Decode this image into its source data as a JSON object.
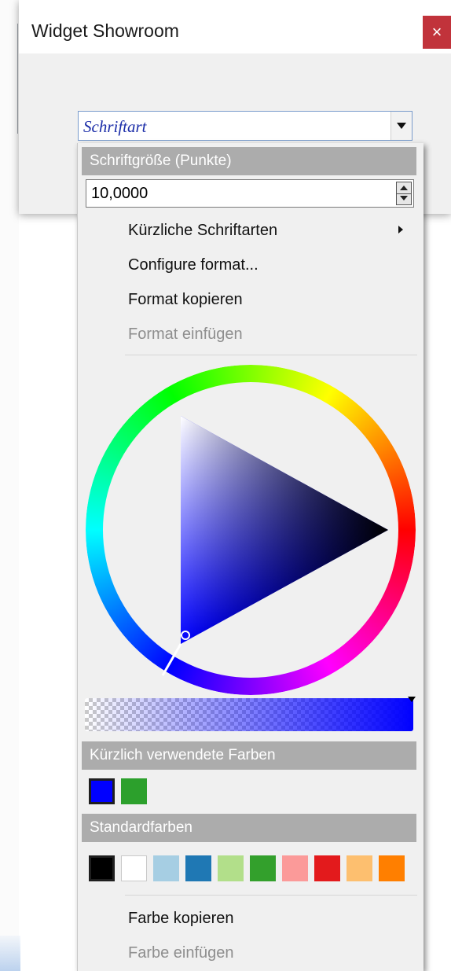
{
  "window": {
    "title": "Widget Showroom",
    "close_label": "×"
  },
  "font_combo": {
    "value": "Schriftart"
  },
  "popup": {
    "size_header": "Schriftgröße (Punkte)",
    "size_value": "10,0000",
    "menu": {
      "recent_fonts": "Kürzliche Schriftarten",
      "configure": "Configure format...",
      "copy_format": "Format kopieren",
      "paste_format": "Format einfügen"
    },
    "color": {
      "current": "#0000ff",
      "alpha_percent": 100
    },
    "recent_colors_header": "Kürzlich verwendete Farben",
    "recent_colors": [
      "#0000ff",
      "#2ca02c"
    ],
    "standard_colors_header": "Standardfarben",
    "standard_colors": [
      "#000000",
      "#ffffff",
      "#a6cee3",
      "#1f78b4",
      "#b2df8a",
      "#33a02c",
      "#fb9a99",
      "#e31a1c",
      "#fdbf6f",
      "#ff7f00"
    ],
    "color_menu": {
      "copy_color": "Farbe kopieren",
      "paste_color": "Farbe einfügen"
    }
  }
}
